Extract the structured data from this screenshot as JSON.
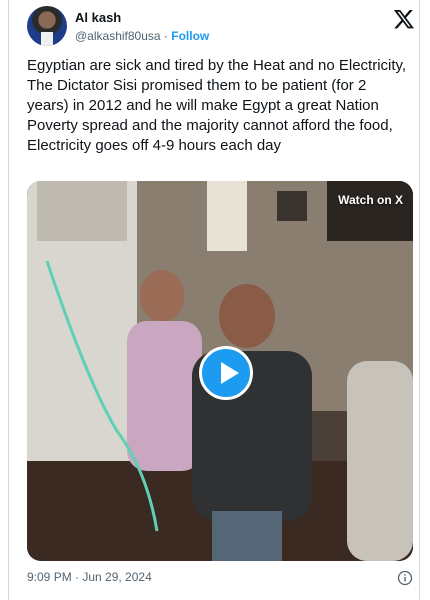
{
  "author": {
    "name": "Al kash",
    "handle": "@alkashif80usa",
    "separator": "·",
    "follow_label": "Follow"
  },
  "tweet": {
    "lines": [
      "Egyptian are sick and tired by the Heat and no Electricity,",
      "The Dictator Sisi promised them to be patient (for 2 years) in 2012 and he will make Egypt a great Nation",
      "Poverty spread and the majority cannot afford the food, Electricity goes off 4-9 hours each day"
    ]
  },
  "video": {
    "watch_label": "Watch on X",
    "play_icon": "play-icon"
  },
  "meta": {
    "timestamp": "9:09 PM · Jun 29, 2024",
    "info_icon": "info-icon"
  },
  "colors": {
    "accent": "#1d9bf0",
    "text": "#0f1419",
    "muted": "#536471",
    "border": "#cfd9de"
  }
}
